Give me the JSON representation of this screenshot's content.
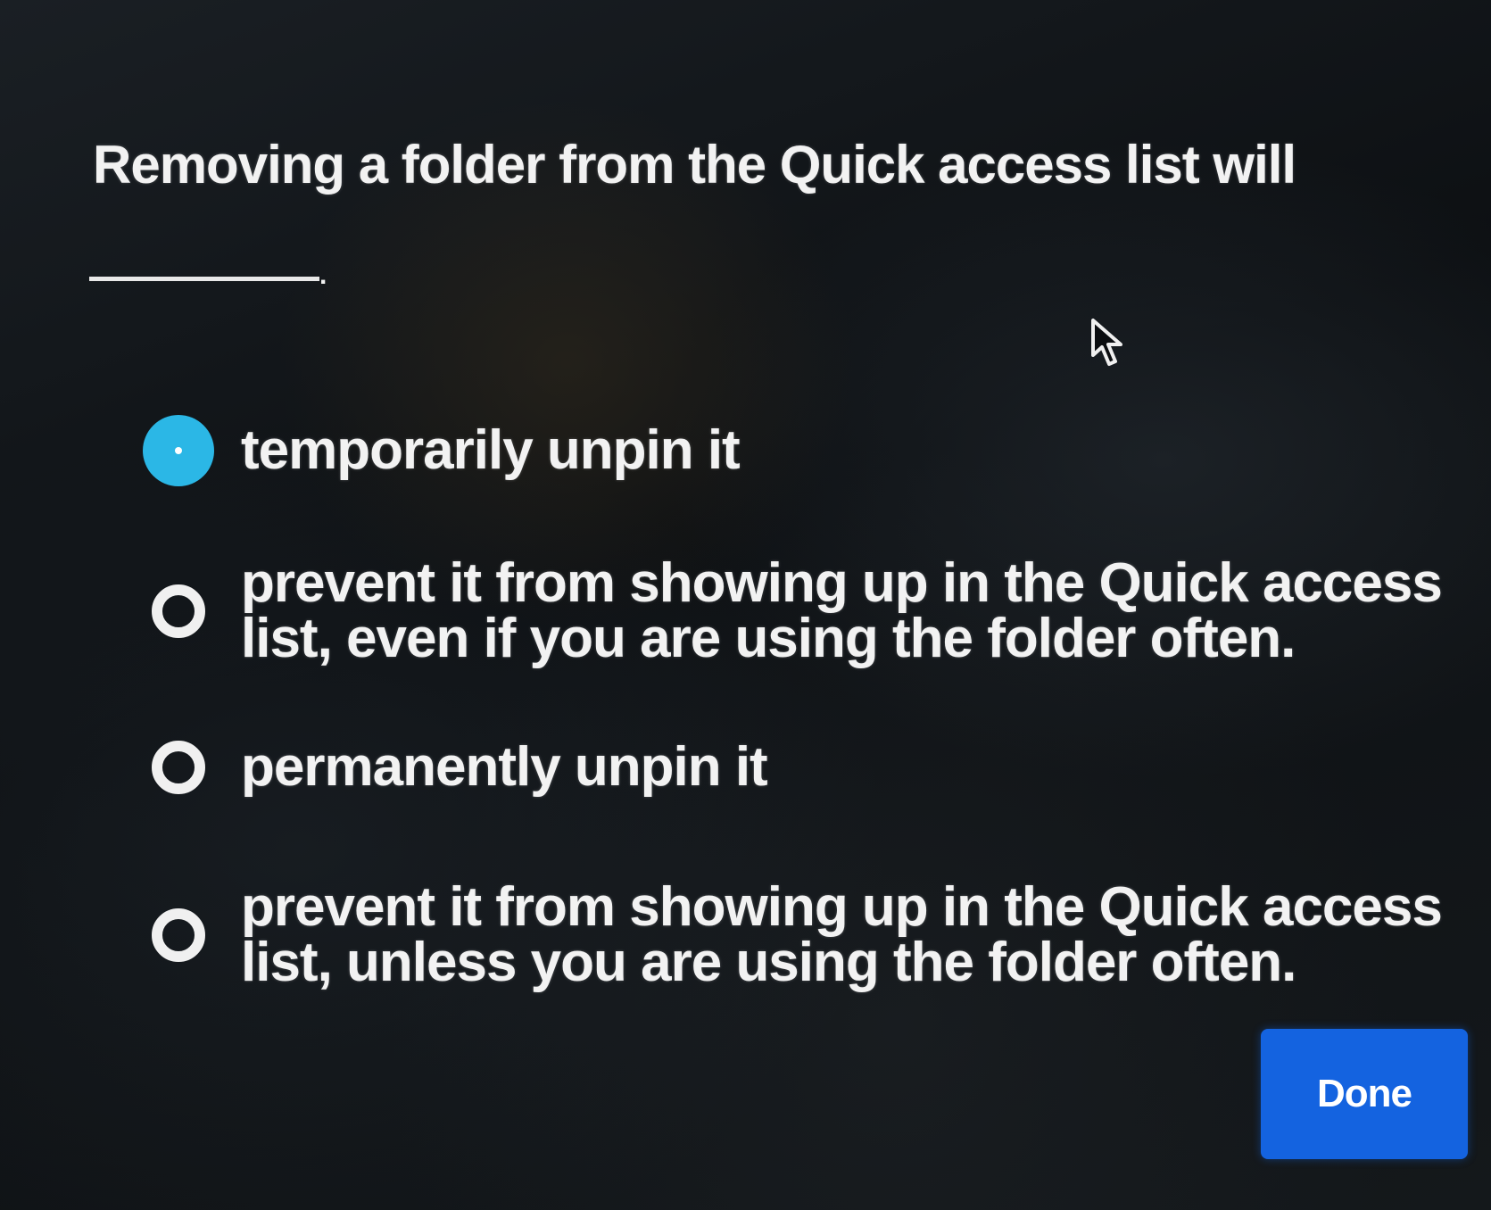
{
  "question": {
    "text": "Removing a folder from the Quick access list will",
    "blank_suffix": "."
  },
  "options": [
    {
      "label": "temporarily unpin it",
      "selected": true
    },
    {
      "label": "prevent it from showing up in the Quick access list, even if you are using the folder often.",
      "selected": false
    },
    {
      "label": "permanently unpin it",
      "selected": false
    },
    {
      "label": "prevent it from showing up in the Quick access list, unless you are using the folder often.",
      "selected": false
    }
  ],
  "done_button": {
    "label": "Done"
  },
  "colors": {
    "accent_radio": "#2bb7e6",
    "button": "#1463e0",
    "text": "#f2f2f2"
  },
  "icons": {
    "cursor": "mouse-pointer-icon"
  }
}
